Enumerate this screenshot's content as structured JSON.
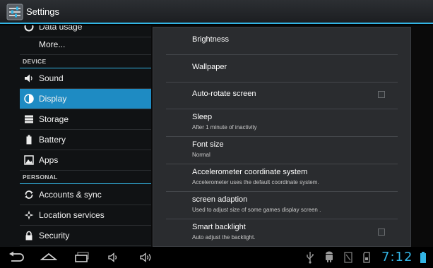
{
  "app": {
    "title": "Settings"
  },
  "sidebar": {
    "items": [
      {
        "label": "Data usage",
        "icon": "data-usage-icon"
      },
      {
        "label": "More..."
      },
      {
        "header": "DEVICE"
      },
      {
        "label": "Sound",
        "icon": "speaker-icon"
      },
      {
        "label": "Display",
        "icon": "display-icon",
        "selected": true
      },
      {
        "label": "Storage",
        "icon": "storage-icon"
      },
      {
        "label": "Battery",
        "icon": "battery-icon"
      },
      {
        "label": "Apps",
        "icon": "apps-icon"
      },
      {
        "header": "PERSONAL"
      },
      {
        "label": "Accounts & sync",
        "icon": "sync-icon"
      },
      {
        "label": "Location services",
        "icon": "location-icon"
      },
      {
        "label": "Security",
        "icon": "lock-icon"
      }
    ]
  },
  "display": {
    "rows": [
      {
        "title": "Brightness"
      },
      {
        "title": "Wallpaper"
      },
      {
        "title": "Auto-rotate screen",
        "checkbox": false
      },
      {
        "title": "Sleep",
        "summary": "After 1 minute of inactivity"
      },
      {
        "title": "Font size",
        "summary": "Normal"
      },
      {
        "title": "Accelerometer coordinate system",
        "summary": "Accelerometer uses the default coordinate system."
      },
      {
        "title": "screen adaption",
        "summary": "Used to adjust size of some games display screen ."
      },
      {
        "title": "Smart backlight",
        "summary": "Auto adjust the backlight.",
        "checkbox": false
      }
    ]
  },
  "navbar": {
    "buttons": [
      "back-icon",
      "home-icon",
      "recent-apps-icon",
      "volume-down-icon",
      "volume-up-icon"
    ],
    "status_icons": [
      "usb-icon",
      "android-debug-icon",
      "screenshot-icon",
      "sd-card-icon",
      "battery-status-icon"
    ],
    "time": "7:12"
  },
  "colors": {
    "accent": "#33b5e5",
    "selected": "#1e8bc3",
    "panel": "#2a2c2f"
  }
}
